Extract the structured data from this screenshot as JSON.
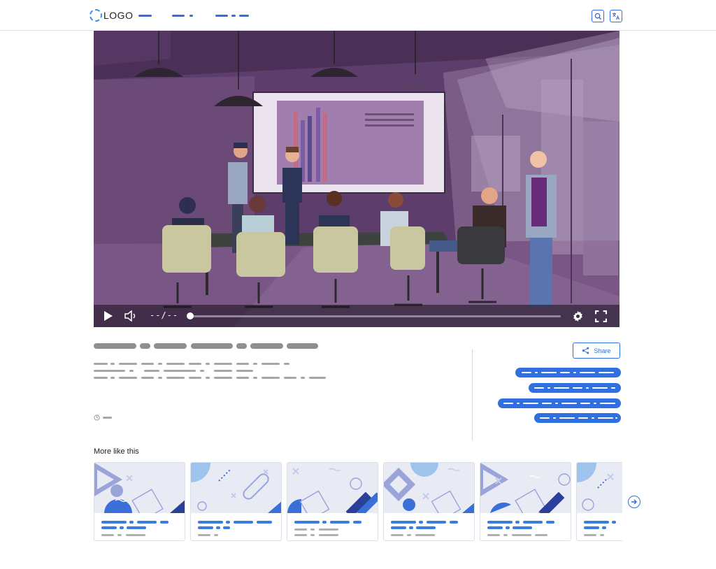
{
  "header": {
    "logo_text": "LOGO",
    "nav_items": [
      "nav-1",
      "nav-2",
      "nav-3"
    ],
    "icons": [
      "search-icon",
      "translate-icon"
    ],
    "accent_color": "#2f6fe0"
  },
  "video": {
    "time_display": "--/--",
    "progress": 0.0,
    "controls": [
      "play-icon",
      "volume-icon",
      "settings-icon",
      "fullscreen-icon"
    ]
  },
  "actions": {
    "share_label": "Share"
  },
  "more": {
    "title": "More like this",
    "card_count": 6
  }
}
